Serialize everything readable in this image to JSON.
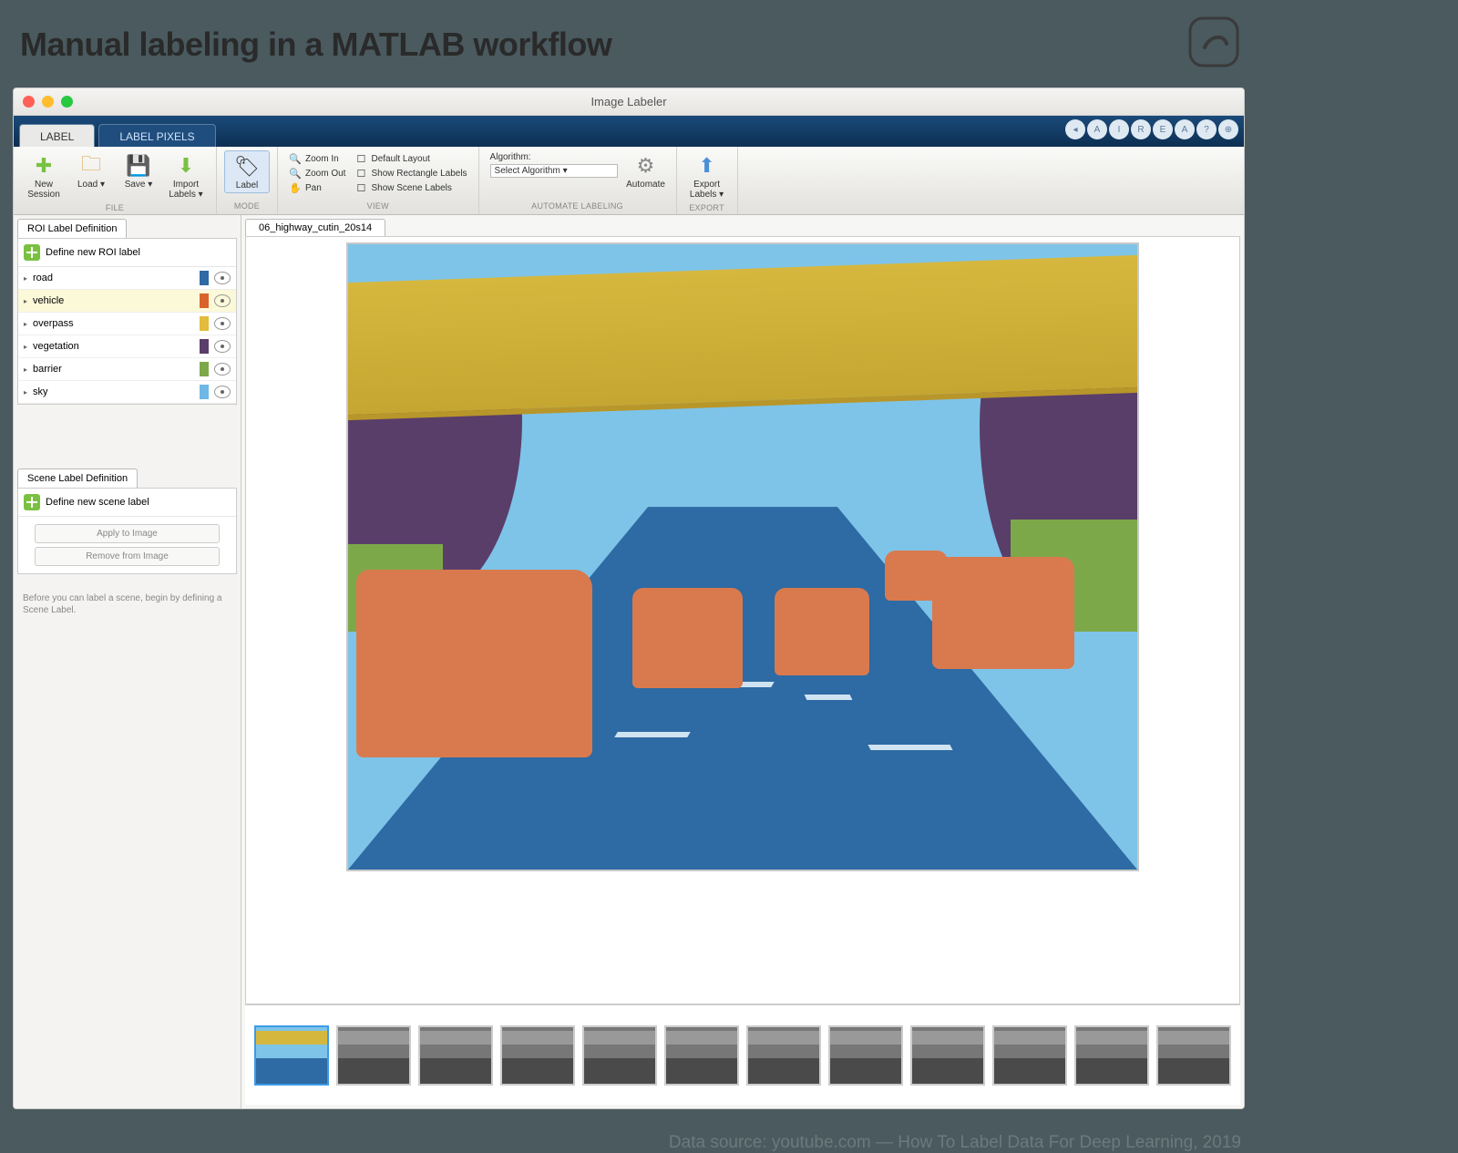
{
  "slide": {
    "title": "Manual labeling in a MATLAB workflow",
    "attribution": "Data source: youtube.com — How To Label Data For Deep Learning, 2019"
  },
  "window": {
    "title": "Image Labeler"
  },
  "tabs": {
    "primary": "LABEL",
    "secondary": "LABEL PIXELS"
  },
  "ribbon": {
    "file": {
      "caption": "FILE",
      "new_session": "New Session",
      "load": "Load ▾",
      "save": "Save ▾",
      "import": "Import Labels ▾"
    },
    "mode": {
      "caption": "MODE",
      "label": "Label"
    },
    "view": {
      "caption": "VIEW",
      "zoom_in": "Zoom In",
      "zoom_out": "Zoom Out",
      "pan": "Pan",
      "default_layout": "Default Layout",
      "show_rect": "Show Rectangle Labels",
      "show_scene": "Show Scene Labels"
    },
    "automate": {
      "caption": "AUTOMATE LABELING",
      "algorithm_label": "Algorithm:",
      "select_algo": "Select Algorithm ▾",
      "automate": "Automate"
    },
    "export": {
      "caption": "EXPORT",
      "export_labels": "Export Labels ▾"
    }
  },
  "roi_panel": {
    "title": "ROI Label Definition",
    "define": "Define new ROI label",
    "labels": [
      {
        "name": "road",
        "color": "#2e6aa3",
        "selected": false
      },
      {
        "name": "vehicle",
        "color": "#d9632a",
        "selected": true
      },
      {
        "name": "overpass",
        "color": "#e2bc3a",
        "selected": false
      },
      {
        "name": "vegetation",
        "color": "#5a3e6a",
        "selected": false
      },
      {
        "name": "barrier",
        "color": "#7da84a",
        "selected": false
      },
      {
        "name": "sky",
        "color": "#6eb8e6",
        "selected": false
      }
    ]
  },
  "scene_panel": {
    "title": "Scene Label Definition",
    "define": "Define new scene label",
    "apply": "Apply to Image",
    "remove": "Remove from Image",
    "hint": "Before you can label a scene, begin by defining a Scene Label."
  },
  "document": {
    "filename": "06_highway_cutin_20s14"
  },
  "filmstrip": {
    "count": 12,
    "selected_index": 0
  }
}
